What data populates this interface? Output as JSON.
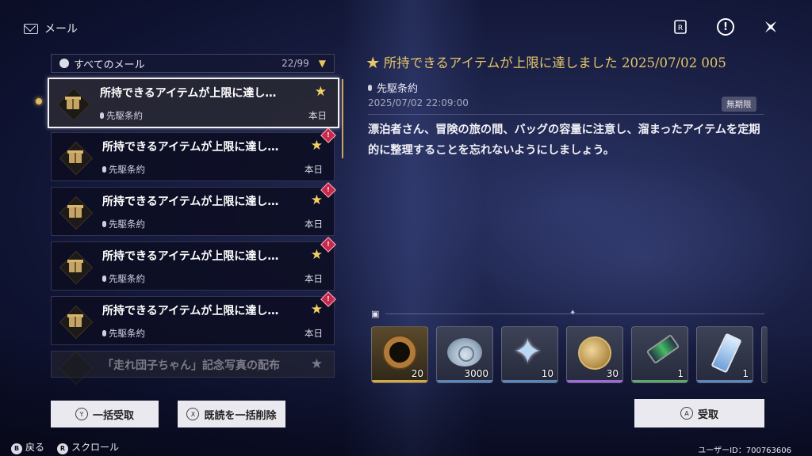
{
  "header": {
    "title": "メール"
  },
  "filter": {
    "label": "すべてのメール",
    "count": "22/99"
  },
  "mails": [
    {
      "title": "所持できるアイテムが上限に達し…",
      "sender": "先駆条約",
      "date": "本日",
      "badge": ""
    },
    {
      "title": "所持できるアイテムが上限に達し…",
      "sender": "先駆条約",
      "date": "本日",
      "badge": "!"
    },
    {
      "title": "所持できるアイテムが上限に達し…",
      "sender": "先駆条約",
      "date": "本日",
      "badge": "!"
    },
    {
      "title": "所持できるアイテムが上限に達し…",
      "sender": "先駆条約",
      "date": "本日",
      "badge": "!"
    },
    {
      "title": "所持できるアイテムが上限に達し…",
      "sender": "先駆条約",
      "date": "本日",
      "badge": "!"
    },
    {
      "title": "「走れ団子ちゃん」記念写真の配布",
      "sender": "",
      "date": "",
      "badge": ""
    }
  ],
  "buttons": {
    "claim_all": "一括受取",
    "claim_all_key": "Y",
    "delete_read": "既読を一括削除",
    "delete_read_key": "X",
    "receive": "受取",
    "receive_key": "A"
  },
  "footer": {
    "back": "戻る",
    "back_key": "B",
    "scroll": "スクロール",
    "scroll_key": "R",
    "user_id": "ユーザーID：700763606"
  },
  "detail": {
    "title": "★ 所持できるアイテムが上限に達しました 2025/07/02 005",
    "sender": "先駆条約",
    "timestamp": "2025/07/02 22:09:00",
    "expiry": "無期限",
    "body": "漂泊者さん、冒険の旅の間、バッグの容量に注意し、溜まったアイテムを定期的に整理することを忘れないようにしましょう。"
  },
  "rewards": [
    {
      "icon": "black-hole-ring-icon",
      "count": "20",
      "rarity_color": "#d2a948"
    },
    {
      "icon": "shell-credit-icon",
      "count": "3000",
      "rarity_color": "#5b86b8"
    },
    {
      "icon": "crystal-star-icon",
      "count": "10",
      "rarity_color": "#5b86b8"
    },
    {
      "icon": "gold-coin-icon",
      "count": "30",
      "rarity_color": "#a06ad6"
    },
    {
      "icon": "green-tube-icon",
      "count": "1",
      "rarity_color": "#5ea86a"
    },
    {
      "icon": "blue-vial-icon",
      "count": "1",
      "rarity_color": "#5b86b8"
    }
  ],
  "top_icons": [
    "bookmark-icon",
    "alert-icon",
    "close-icon"
  ]
}
